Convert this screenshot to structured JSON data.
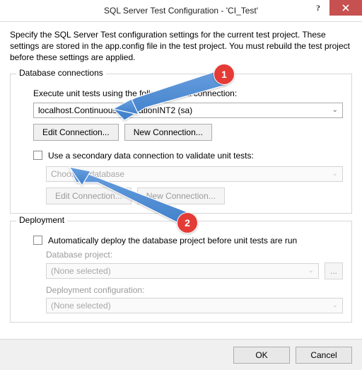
{
  "titlebar": {
    "title": "SQL Server Test Configuration - 'CI_Test'",
    "help_symbol": "?",
    "close_label": "close"
  },
  "intro_text": "Specify the SQL Server Test configuration settings for the current test project. These settings are stored in the app.config file in the test project. You must rebuild the test project before these settings are applied.",
  "db_conn": {
    "group_label": "Database connections",
    "execute_label": "Execute unit tests using the following data connection:",
    "primary_combo_value": "localhost.ContinuousIntegrationINT2 (sa)",
    "edit_connection": "Edit Connection...",
    "new_connection": "New Connection...",
    "secondary_check_label": "Use a secondary data connection to validate unit tests:",
    "secondary_combo_placeholder": "Choose a database",
    "edit_connection2": "Edit Connection...",
    "new_connection2": "New Connection..."
  },
  "deployment": {
    "group_label": "Deployment",
    "auto_deploy_label": "Automatically deploy the database project before unit tests are run",
    "project_label": "Database project:",
    "project_value": "(None selected)",
    "browse": "...",
    "config_label": "Deployment configuration:",
    "config_value": "(None selected)"
  },
  "footer": {
    "ok": "OK",
    "cancel": "Cancel"
  },
  "annotations": {
    "one": "1",
    "two": "2"
  }
}
